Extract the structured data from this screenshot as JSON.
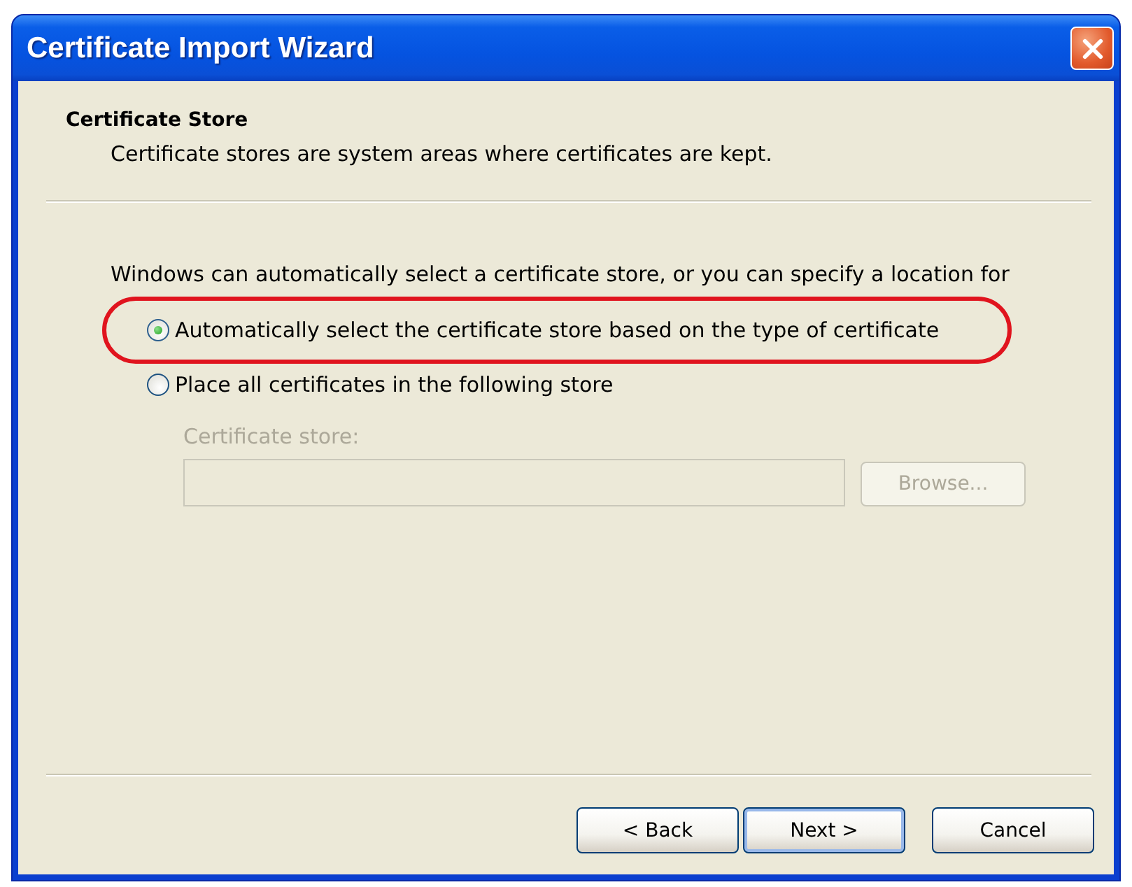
{
  "window": {
    "title": "Certificate Import Wizard"
  },
  "header": {
    "title": "Certificate Store",
    "subtitle": "Certificate stores are system areas where certificates are kept."
  },
  "body": {
    "intro": "Windows can automatically select a certificate store, or you can specify a location for",
    "options": [
      {
        "label": "Automatically select the certificate store based on the type of certificate",
        "selected": true,
        "highlighted": true
      },
      {
        "label": "Place all certificates in the following store",
        "selected": false,
        "highlighted": false
      }
    ],
    "store_field": {
      "label": "Certificate store:",
      "disabled": true
    },
    "browse_button": {
      "label": "Browse...",
      "disabled": true
    }
  },
  "buttons": [
    {
      "label": "< Back",
      "default": false
    },
    {
      "label": "Next >",
      "default": true
    },
    {
      "label": "Cancel",
      "default": false
    }
  ]
}
